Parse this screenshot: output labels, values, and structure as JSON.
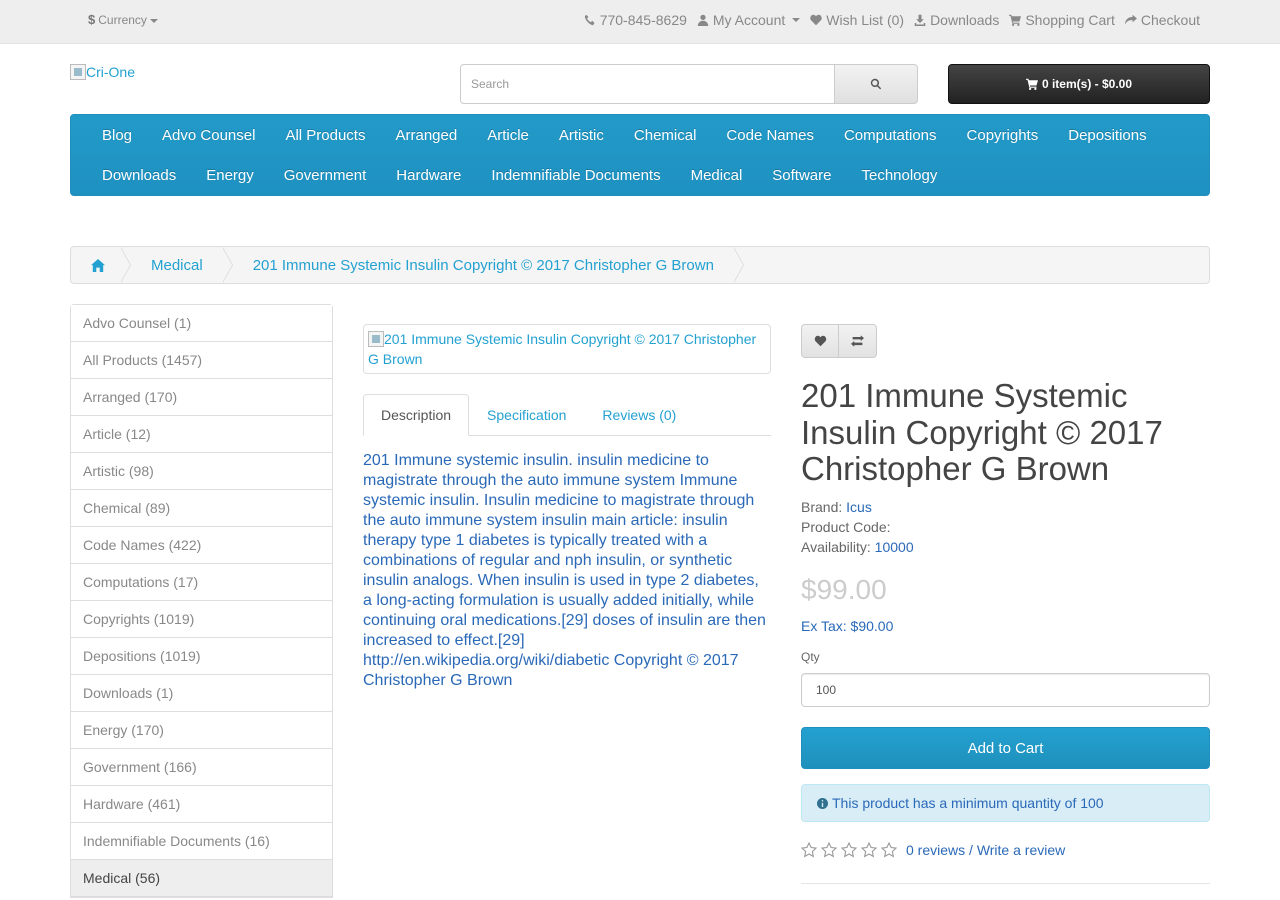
{
  "top_bar": {
    "currency": {
      "symbol": "$",
      "label": "Currency"
    },
    "links": [
      {
        "icon": "phone-icon",
        "label": "770-845-8629"
      },
      {
        "icon": "user-icon",
        "label": "My Account"
      },
      {
        "icon": "heart-icon",
        "label": "Wish List (0)"
      },
      {
        "icon": "download-icon",
        "label": "Downloads"
      },
      {
        "icon": "cart-icon",
        "label": "Shopping Cart"
      },
      {
        "icon": "share-icon",
        "label": "Checkout"
      }
    ]
  },
  "header": {
    "logo_alt": "Cri-One",
    "search_placeholder": "Search",
    "cart_label": "0 item(s) - $0.00"
  },
  "menu": {
    "row1": [
      "Blog",
      "Advo Counsel",
      "All Products",
      "Arranged",
      "Article",
      "Artistic",
      "Chemical",
      "Code Names",
      "Computations",
      "Copyrights",
      "Depositions"
    ],
    "row2": [
      "Downloads",
      "Energy",
      "Government",
      "Hardware",
      "Indemnifiable Documents",
      "Medical",
      "Software",
      "Technology"
    ]
  },
  "breadcrumb": {
    "home_icon": "home-icon",
    "items": [
      "Medical",
      "201 Immune Systemic Insulin Copyright © 2017 Christopher G Brown"
    ]
  },
  "sidebar": {
    "categories": [
      "Advo Counsel (1)",
      "All Products (1457)",
      "Arranged (170)",
      "Article (12)",
      "Artistic (98)",
      "Chemical (89)",
      "Code Names (422)",
      "Computations (17)",
      "Copyrights (1019)",
      "Depositions (1019)",
      "Downloads (1)",
      "Energy (170)",
      "Government (166)",
      "Hardware (461)",
      "Indemnifiable Documents (16)",
      "Medical (56)"
    ],
    "active": "Medical (56)"
  },
  "product": {
    "image_alt": "201 Immune Systemic Insulin Copyright © 2017 Christopher G Brown",
    "tabs": [
      "Description",
      "Specification",
      "Reviews (0)"
    ],
    "description": "201 Immune systemic insulin. insulin medicine to magistrate through the auto immune system Immune systemic insulin. Insulin medicine to magistrate through the auto immune system insulin main article: insulin therapy type 1 diabetes is typically treated with a combinations of regular and nph insulin, or synthetic insulin analogs. When insulin is used in type 2 diabetes, a long-acting formulation is usually added initially, while continuing oral medications.[29] doses of insulin are then increased to effect.[29] http://en.wikipedia.org/wiki/diabetic Copyright © 2017 Christopher G Brown",
    "title": "201 Immune Systemic Insulin Copyright © 2017 Christopher G Brown",
    "brand_label": "Brand:",
    "brand": "Icus",
    "code_label": "Product Code:",
    "availability_label": "Availability:",
    "availability": "10000",
    "price": "$99.00",
    "ex_tax": "Ex Tax: $90.00",
    "qty_label": "Qty",
    "qty_value": "100",
    "add_to_cart": "Add to Cart",
    "min_qty_notice": "This product has a minimum quantity of 100",
    "rating": 0,
    "reviews_link": "0 reviews",
    "separator": " / ",
    "write_review": "Write a review"
  },
  "colors": {
    "accent": "#23a1d1",
    "menu_bg": "#229ac8",
    "link": "#2a69b8",
    "info_bg": "#d9edf7"
  }
}
